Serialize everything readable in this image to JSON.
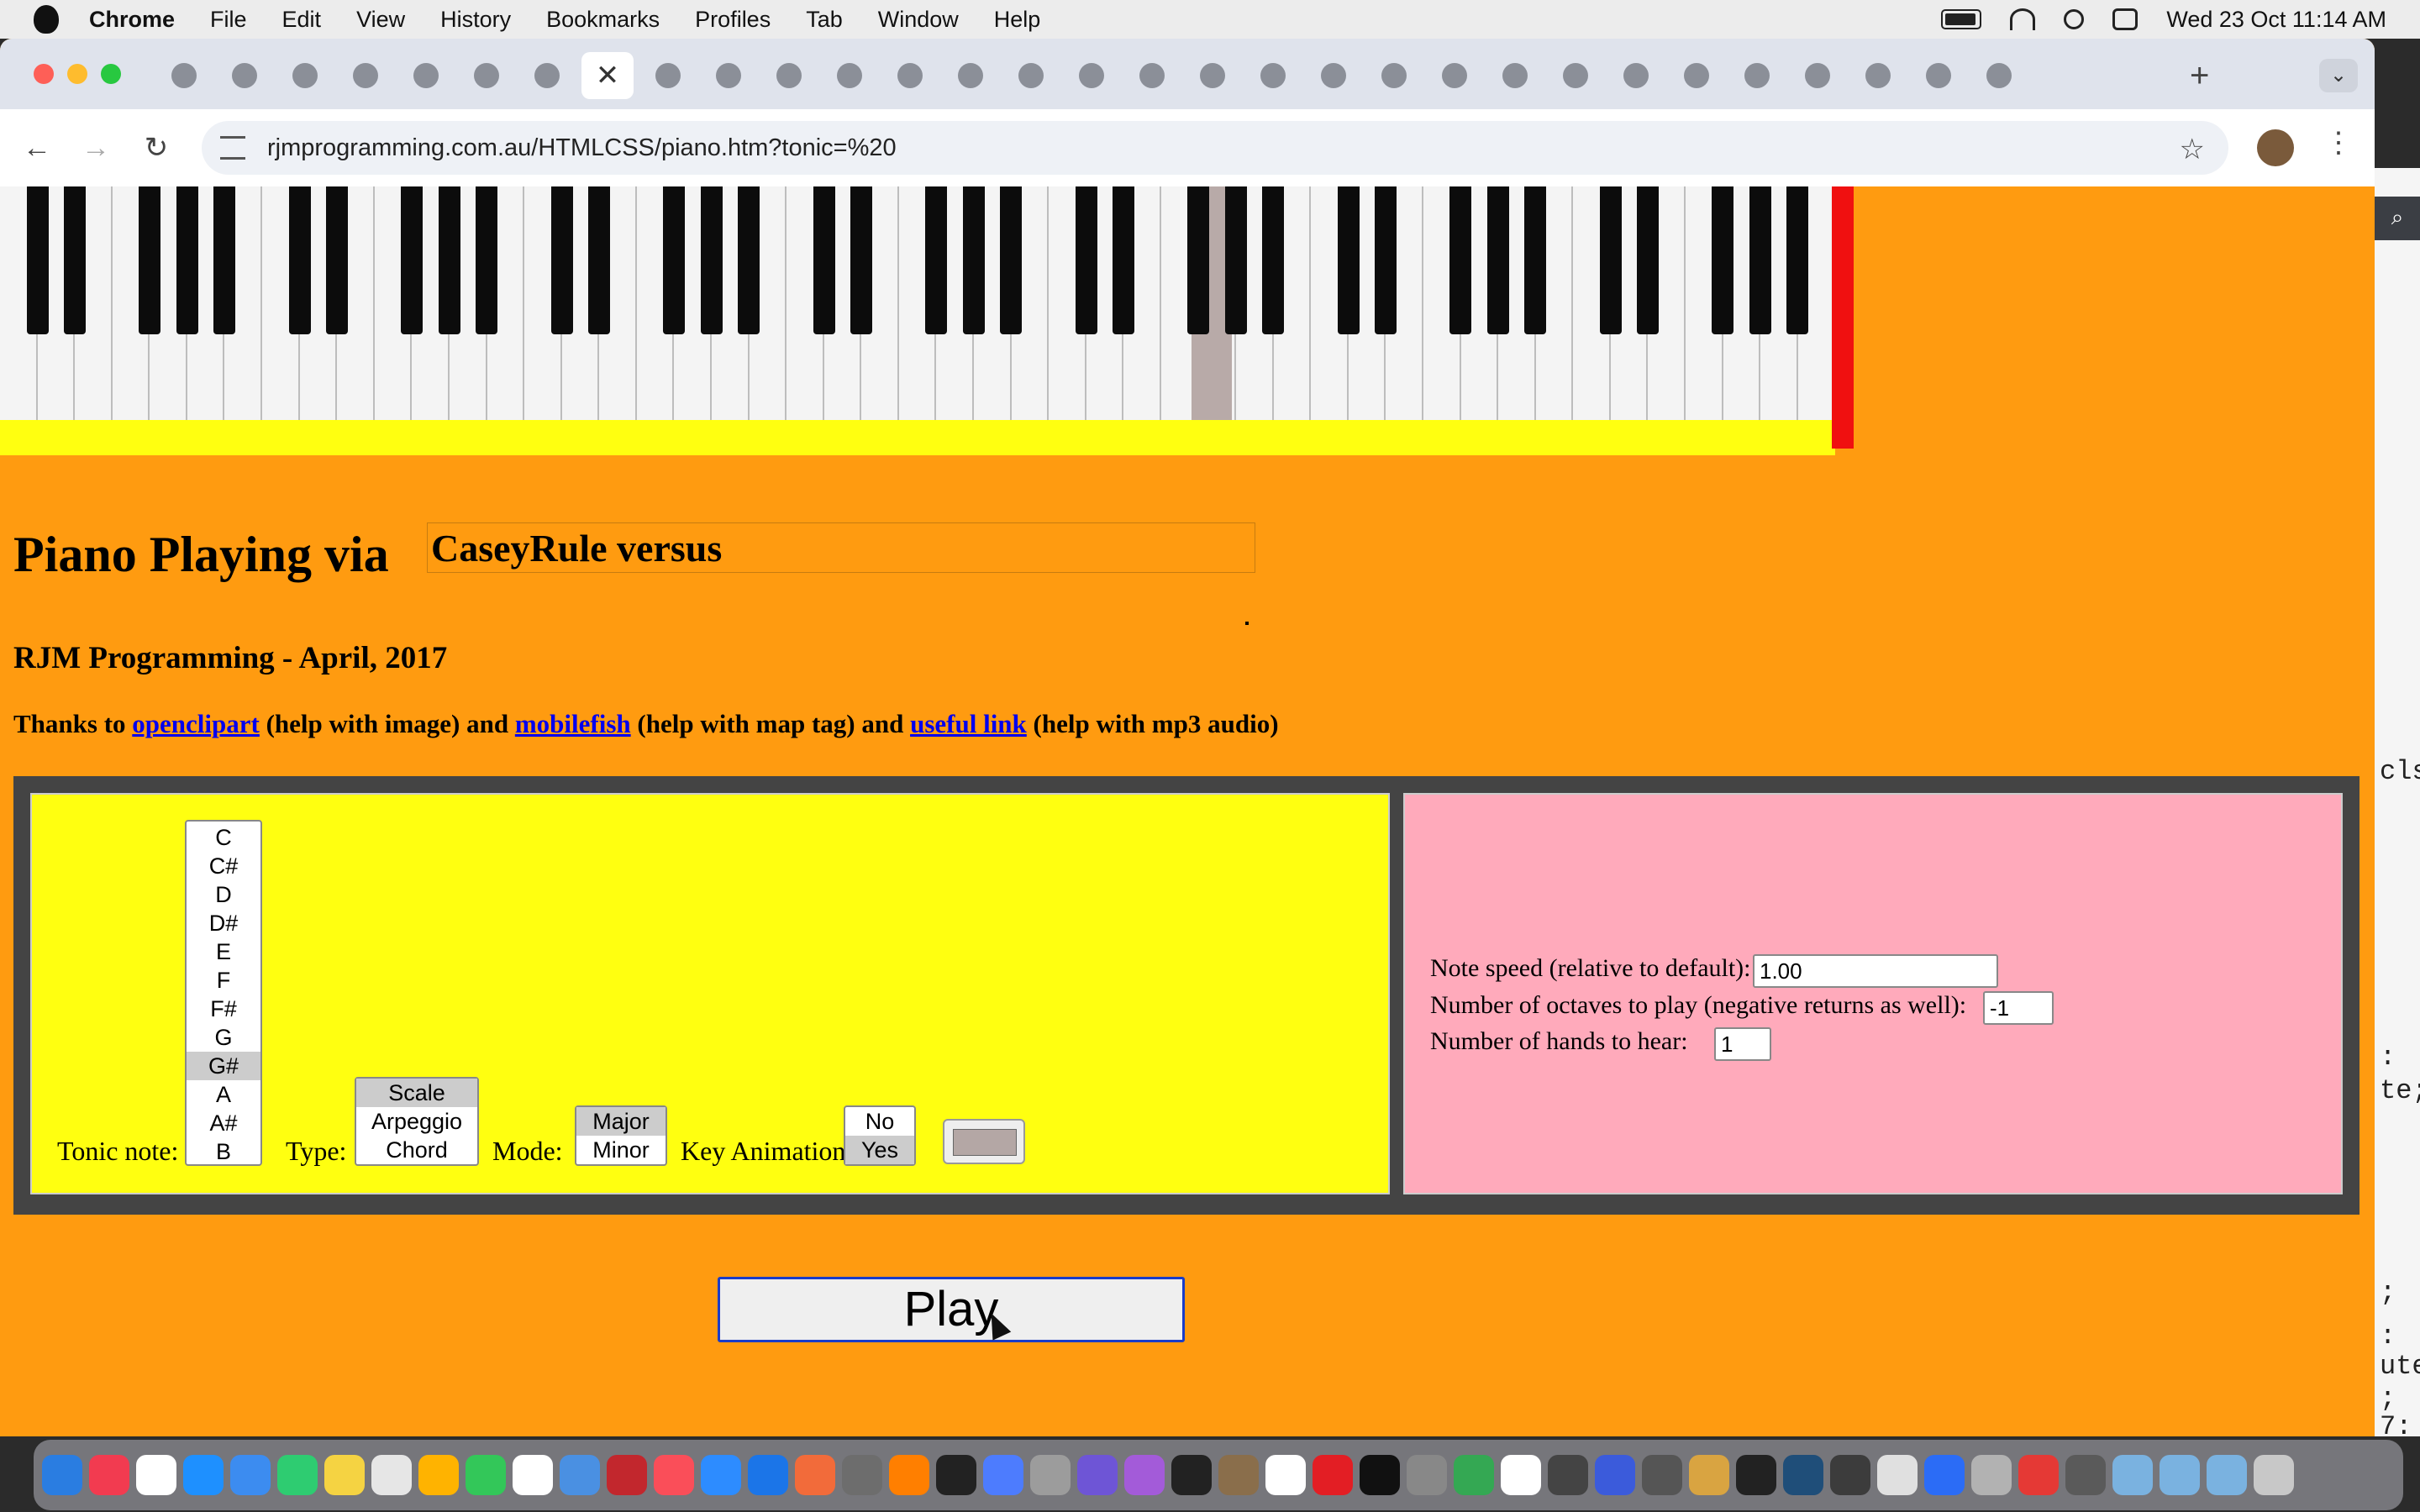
{
  "menubar": {
    "app": "Chrome",
    "items": [
      "File",
      "Edit",
      "View",
      "History",
      "Bookmarks",
      "Profiles",
      "Tab",
      "Window",
      "Help"
    ],
    "datetime": "Wed 23 Oct  11:14 AM"
  },
  "browser": {
    "url": "rjmprogramming.com.au/HTMLCSS/piano.htm?tonic=%20",
    "active_tab_icon": "close-icon",
    "colors": {
      "tabstrip": "#dfe3ec",
      "page_bg": "#ff9b10"
    }
  },
  "page": {
    "title": "Piano Playing via",
    "title_box": "CaseyRule versus",
    "subtitle": "RJM Programming - April, 2017",
    "thanks": {
      "t1": "Thanks to ",
      "link1": "openclipart",
      "t2": " (help with image) and ",
      "link2": "mobilefish",
      "t3": " (help with map tag) and ",
      "link3": "useful link",
      "t4": " (help with mp3 audio)"
    },
    "controls": {
      "tonic_label": "Tonic note:",
      "tonic_options": [
        "C",
        "C#",
        "D",
        "D#",
        "E",
        "F",
        "F#",
        "G",
        "G#",
        "A",
        "A#",
        "B"
      ],
      "tonic_selected": "G#",
      "type_label": "Type:",
      "type_options": [
        "Scale",
        "Arpeggio",
        "Chord"
      ],
      "type_selected": "Scale",
      "mode_label": "Mode:",
      "mode_options": [
        "Major",
        "Minor"
      ],
      "mode_selected": "Major",
      "anim_label": "Key Animation:",
      "anim_options": [
        "No",
        "Yes"
      ],
      "anim_selected": "Yes",
      "color_value": "#b4a7a5"
    },
    "settings": {
      "speed_label": "Note speed (relative to default):",
      "speed_value": "1.00",
      "octaves_label": "Number of octaves to play (negative returns as well):",
      "octaves_value": "-1",
      "hands_label": "Number of hands to hear:",
      "hands_value": "1"
    },
    "play_label": "Play"
  },
  "side_code": [
    ":",
    "te;",
    ";",
    ":",
    "ute",
    ";",
    "7:"
  ],
  "side_code_top": "cls"
}
